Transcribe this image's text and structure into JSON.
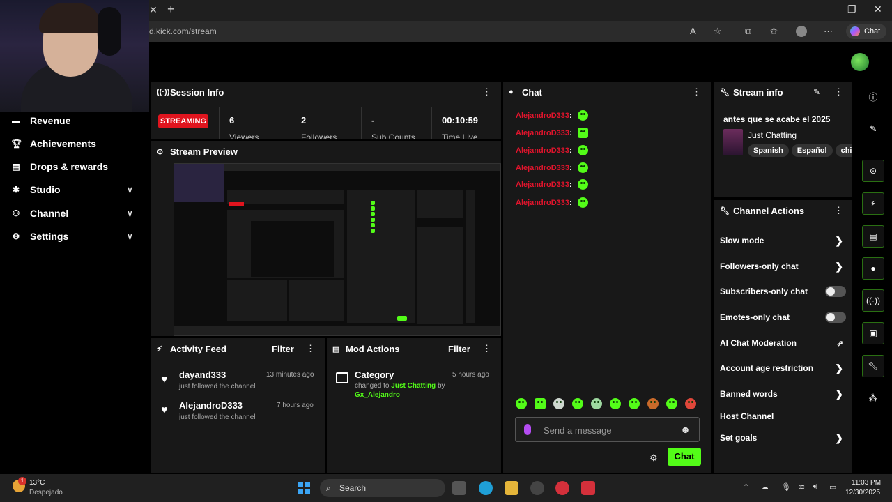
{
  "browser": {
    "url": "d.kick.com/stream",
    "copilot_label": "Chat"
  },
  "sidebar": {
    "items": [
      {
        "label": "Revenue",
        "icon": "dollar-icon"
      },
      {
        "label": "Achievements",
        "icon": "trophy-icon"
      },
      {
        "label": "Drops & rewards",
        "icon": "drops-icon"
      },
      {
        "label": "Studio",
        "icon": "studio-icon"
      },
      {
        "label": "Channel",
        "icon": "channel-icon"
      },
      {
        "label": "Settings",
        "icon": "gear-icon"
      }
    ]
  },
  "session": {
    "title": "Session Info",
    "status": "STREAMING",
    "stats": [
      {
        "value": "6",
        "label": "Viewers"
      },
      {
        "value": "2",
        "label": "Followers"
      },
      {
        "value": "-",
        "label": "Sub Counts"
      },
      {
        "value": "00:10:59",
        "label": "Time Live"
      }
    ]
  },
  "preview": {
    "title": "Stream Preview"
  },
  "activity": {
    "title": "Activity Feed",
    "filter": "Filter",
    "items": [
      {
        "name": "dayand333",
        "sub": "just followed the channel",
        "time": "13 minutes ago"
      },
      {
        "name": "AlejandroD333",
        "sub": "just followed the channel",
        "time": "7 hours ago"
      }
    ]
  },
  "mod": {
    "title": "Mod Actions",
    "filter": "Filter",
    "item": {
      "title": "Category",
      "time": "5 hours ago",
      "line1_prefix": "changed to",
      "category": "Just Chatting",
      "line1_suffix": "by",
      "user": "Gx_Alejandro"
    }
  },
  "chat": {
    "title": "Chat",
    "messages": [
      {
        "user": "AlejandroD333"
      },
      {
        "user": "AlejandroD333"
      },
      {
        "user": "AlejandroD333"
      },
      {
        "user": "AlejandroD333"
      },
      {
        "user": "AlejandroD333"
      },
      {
        "user": "AlejandroD333"
      }
    ],
    "placeholder": "Send a message",
    "send_label": "Chat"
  },
  "stream_info": {
    "title": "Stream info",
    "stream_title": "antes que se acabe el 2025",
    "category": "Just Chatting",
    "tags": [
      "Spanish",
      "Español",
      "chi"
    ]
  },
  "channel_actions": {
    "title": "Channel Actions",
    "rows": [
      {
        "label": "Slow mode",
        "control": "arrow"
      },
      {
        "label": "Followers-only chat",
        "control": "arrow"
      },
      {
        "label": "Subscribers-only chat",
        "control": "toggle"
      },
      {
        "label": "Emotes-only chat",
        "control": "toggle"
      },
      {
        "label": "AI Chat Moderation",
        "control": "external"
      },
      {
        "label": "Account age restriction",
        "control": "arrow"
      },
      {
        "label": "Banned words",
        "control": "arrow"
      },
      {
        "label": "Host Channel",
        "control": "none"
      },
      {
        "label": "Set goals",
        "control": "arrow"
      }
    ]
  },
  "taskbar": {
    "temp": "13°C",
    "weather": "Despejado",
    "weather_badge": "1",
    "search": "Search",
    "time": "11:03 PM",
    "date": "12/30/2025"
  },
  "colors": {
    "accent": "#53fc18",
    "live": "#e0141e",
    "chat_user": "#e0142c"
  }
}
